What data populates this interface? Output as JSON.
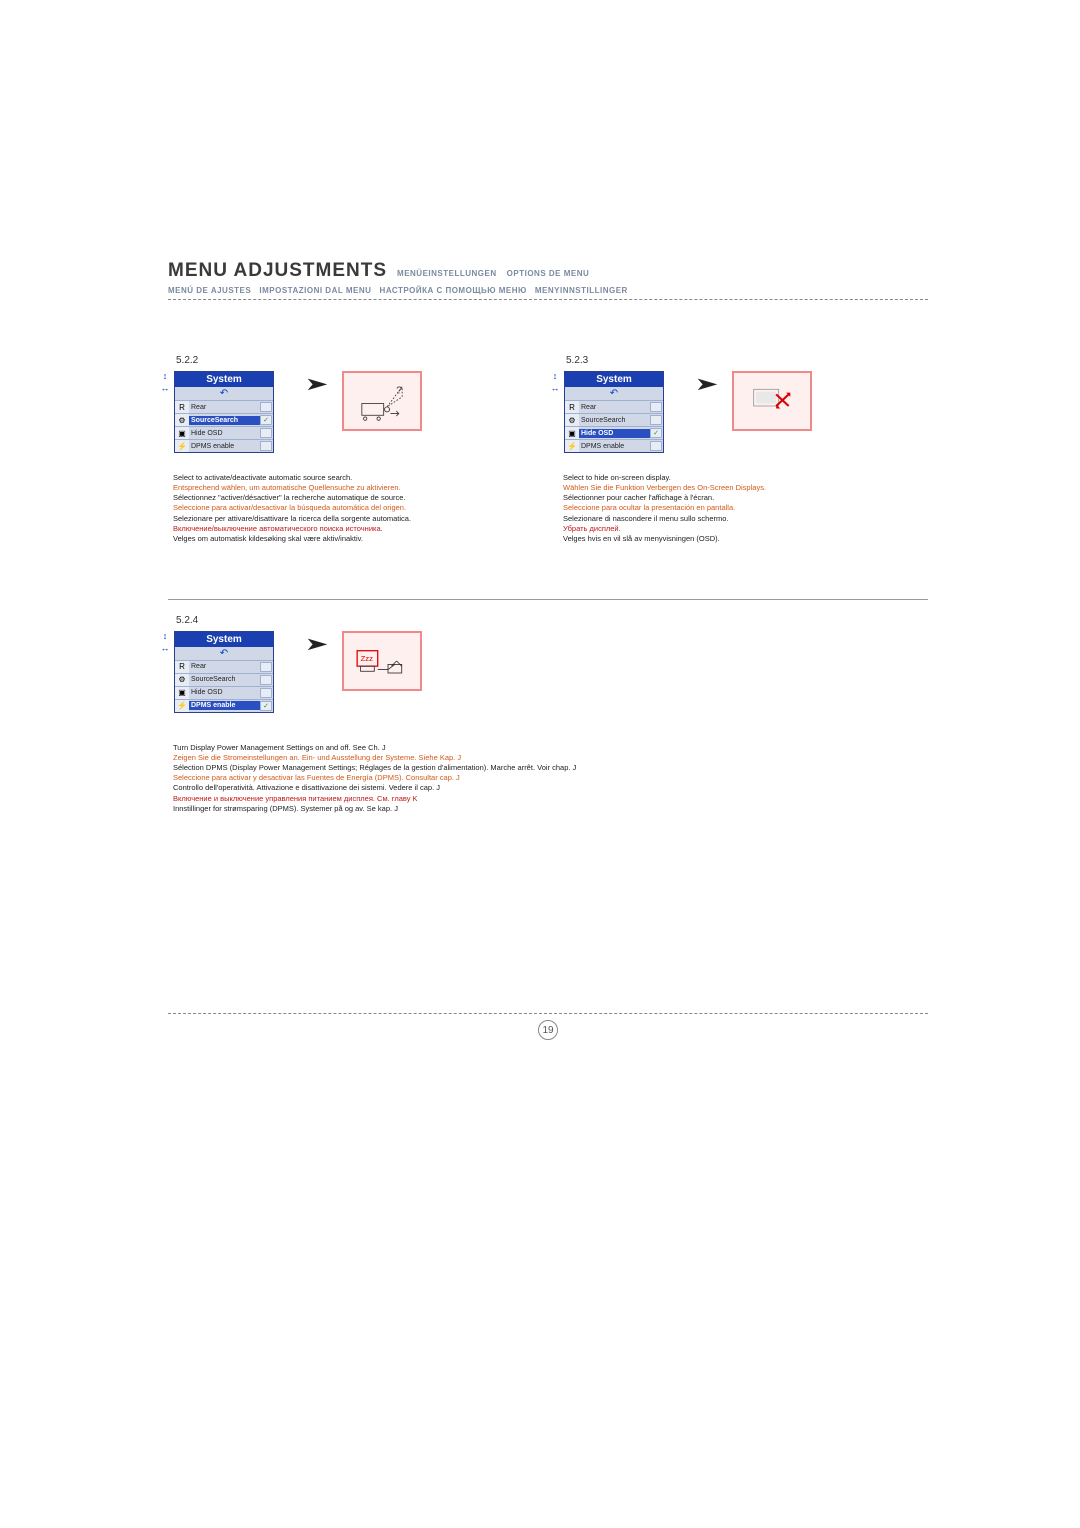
{
  "header": {
    "title": "MENU ADJUSTMENTS",
    "sub_de": "MENÜEINSTELLUNGEN",
    "sub_fr": "OPTIONS DE MENU",
    "sub_es": "MENÚ DE AJUSTES",
    "sub_it": "IMPOSTAZIONI DAL MENU",
    "sub_ru": "НАСТРОЙКА С ПОМОЩЬЮ МЕНЮ",
    "sub_no": "MENYINNSTILLINGER"
  },
  "menu": {
    "title": "System",
    "items": [
      "Rear",
      "SourceSearch",
      "Hide OSD",
      "DPMS enable"
    ]
  },
  "sections": {
    "s522": {
      "num": "5.2.2",
      "selected_index": 1,
      "check_index": 1,
      "desc": [
        {
          "text": "Select to activate/deactivate automatic source search.",
          "cls": "c-black"
        },
        {
          "text": "Entsprechend wählen, um automatische Quellensuche zu aktivieren.",
          "cls": "c-orange"
        },
        {
          "text": "Sélectionnez \"activer/désactiver\" la recherche automatique de source.",
          "cls": "c-black"
        },
        {
          "text": "Seleccione para activar/desactivar la búsqueda automática del origen.",
          "cls": "c-orange"
        },
        {
          "text": "Selezionare per attivare/disattivare la ricerca della sorgente automatica.",
          "cls": "c-black"
        },
        {
          "text": "Включение/выключение автоматического поиска источника.",
          "cls": "c-red"
        },
        {
          "text": "Velges om automatisk kildesøking skal være aktiv/inaktiv.",
          "cls": "c-black"
        }
      ]
    },
    "s523": {
      "num": "5.2.3",
      "selected_index": 2,
      "check_index": 2,
      "desc": [
        {
          "text": "Select to hide on-screen display.",
          "cls": "c-black"
        },
        {
          "text": "Wählen Sie die Funktion Verbergen des On-Screen Displays.",
          "cls": "c-orange"
        },
        {
          "text": "Sélectionner pour cacher l'affichage à l'écran.",
          "cls": "c-black"
        },
        {
          "text": "Seleccione para ocultar la presentación en pantalla.",
          "cls": "c-orange"
        },
        {
          "text": "Selezionare di nascondere il menu sullo schermo.",
          "cls": "c-black"
        },
        {
          "text": "Убрать дисплей.",
          "cls": "c-red"
        },
        {
          "text": "Velges hvis en vil slå av menyvisningen (OSD).",
          "cls": "c-black"
        }
      ]
    },
    "s524": {
      "num": "5.2.4",
      "selected_index": 3,
      "check_index": 3,
      "desc": [
        {
          "text": "Turn Display Power Management Settings on and off. See Ch. J",
          "cls": "c-black"
        },
        {
          "text": "Zeigen Sie die Stromeinstellungen an. Ein- und Ausstellung der Systeme. Siehe Kap. J",
          "cls": "c-orange"
        },
        {
          "text": "Sélection DPMS (Display Power Management Settings; Réglages de la gestion d'alimentation). Marche arrêt. Voir chap. J",
          "cls": "c-black"
        },
        {
          "text": "Seleccione para activar y desactivar las Fuentes de Energía (DPMS). Consultar cap. J",
          "cls": "c-orange"
        },
        {
          "text": "Controllo dell'operatività.  Attivazione e disattivazione dei sistemi. Vedere il cap. J",
          "cls": "c-black"
        },
        {
          "text": "Включение и выключение управления питанием дисплея. См. главу K",
          "cls": "c-red"
        },
        {
          "text": "Innstillinger for strømsparing (DPMS). Systemer på og av. Se kap. J",
          "cls": "c-black"
        }
      ]
    }
  },
  "page_number": "19",
  "icons": {
    "rear": "R",
    "search": "⚙",
    "hide": "▣",
    "dpms": "⚡",
    "back": "↶",
    "side1": "↕",
    "side2": "↔",
    "check": "✓"
  }
}
